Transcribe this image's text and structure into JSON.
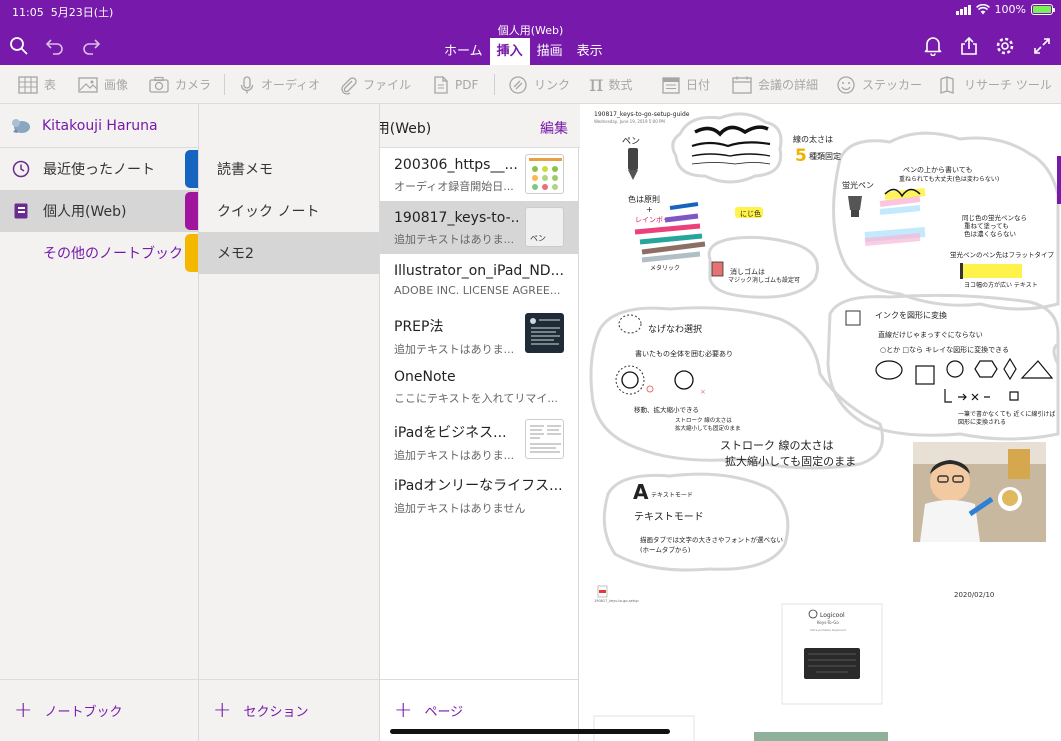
{
  "status_bar": {
    "time": "11:05",
    "date": "5月23日(土)",
    "battery": "100%",
    "battery_level": 1.0
  },
  "app": {
    "document_title": "個人用(Web)",
    "tabs": [
      {
        "label": "ホーム",
        "active": false
      },
      {
        "label": "挿入",
        "active": true
      },
      {
        "label": "描画",
        "active": false
      },
      {
        "label": "表示",
        "active": false
      }
    ],
    "toolbar_icons": [
      "search-icon",
      "undo-icon",
      "redo-icon",
      "bell-icon",
      "share-icon",
      "settings-icon",
      "expand-icon"
    ]
  },
  "ribbon": {
    "items": [
      {
        "icon": "table-icon",
        "label": "表"
      },
      {
        "icon": "image-icon",
        "label": "画像"
      },
      {
        "icon": "camera-icon",
        "label": "カメラ"
      },
      {
        "icon": "microphone-icon",
        "label": "オーディオ"
      },
      {
        "icon": "paperclip-icon",
        "label": "ファイル"
      },
      {
        "icon": "pdf-icon",
        "label": "PDF"
      },
      {
        "icon": "link-icon",
        "label": "リンク"
      },
      {
        "icon": "pi-icon",
        "label": "数式"
      },
      {
        "icon": "calendar-icon",
        "label": "日付"
      },
      {
        "icon": "meeting-icon",
        "label": "会議の詳細"
      },
      {
        "icon": "smiley-icon",
        "label": "ステッカー"
      },
      {
        "icon": "research-icon",
        "label": "リサーチ ツール"
      }
    ]
  },
  "notebooks_pane": {
    "account_name": "Kitakouji Haruna",
    "items": [
      {
        "label": "最近使ったノート",
        "icon": "clock-icon",
        "tag_color": "#1565c0",
        "selected": false
      },
      {
        "label": "個人用(Web)",
        "icon": "notebook-icon",
        "tag_color": "#a0159e",
        "selected": true
      }
    ],
    "other_notebooks": "その他のノートブック",
    "other_tag_color": "#f5b800",
    "footer_label": "ノートブック"
  },
  "sections_pane": {
    "header_title": "個人用(Web)",
    "edit_label": "編集",
    "items": [
      {
        "label": "読書メモ",
        "selected": false
      },
      {
        "label": "クイック ノート",
        "selected": false
      },
      {
        "label": "メモ2",
        "selected": true
      }
    ],
    "footer_label": "セクション"
  },
  "pages_pane": {
    "items": [
      {
        "title": "200306_https__...",
        "snippet": "オーディオ録音開始日...",
        "selected": false
      },
      {
        "title": "190817_keys-to-...",
        "snippet": "追加テキストはありま...",
        "selected": true,
        "thumb_text": "ペン"
      },
      {
        "title": "Illustrator_on_iPad_ND...",
        "snippet": "ADOBE INC.  LICENSE AGREE...",
        "selected": false
      },
      {
        "title": "PREP法",
        "snippet": "追加テキストはありま...",
        "selected": false
      },
      {
        "title": "OneNote",
        "snippet": "ここにテキストを入れてリマイ...",
        "selected": false
      },
      {
        "title": "iPadをビジネス...",
        "snippet": "追加テキストはありま...",
        "selected": false
      },
      {
        "title": "iPadオンリーなライフス...",
        "snippet": "追加テキストはありません",
        "selected": false
      }
    ],
    "footer_label": "ページ"
  },
  "canvas": {
    "page_header": "190817_keys-to-go-setup-guide",
    "page_subheader": "Wednesday, June 19, 2019      5:00 PM",
    "notes": {
      "pen": "ペン",
      "line_width_1": "線の太さは",
      "line_width_2": "5",
      "line_width_3": "種類固定",
      "colors_1": "色は原則",
      "colors_2": "+",
      "rainbow": "レインボー",
      "metallic": "メタリック",
      "rainbow_label": "にじ色",
      "eraser_1": "消しゴムは",
      "eraser_2": "マジック消しゴムも設定可",
      "highlighter": "蛍光ペン",
      "hl_note_1": "ペンの上から書いても",
      "hl_note_2": "重ねられても大丈夫(色は変わらない)",
      "hl_same_1": "同じ色の蛍光ペンなら",
      "hl_same_2": "重ねて塗っても",
      "hl_same_3": "色は濃くならない",
      "hl_tip": "蛍光ペンのペン先はフラットタイプ",
      "hl_width": "ヨコ幅の方が広い テキスト",
      "lasso": "なげなわ選択",
      "lasso_note": "書いたもの全体を囲む必要あり",
      "move": "移動、拡大縮小できる",
      "stroke_note_1": "ストローク 線の太さは",
      "stroke_note_2": "拡大縮小しても固定のまま",
      "big_stroke_1": "ストローク 線の太さは",
      "big_stroke_2": "拡大縮小しても固定のまま",
      "shape_title": "インクを図形に変換",
      "shape_note_1": "直線だけじゃまっすぐにならない",
      "shape_note_2": "○とか □なら キレイな図形に変換できる",
      "shape_note_3": "一筆で書かなくても 近くに線引けば",
      "shape_note_4": "図形に変換される",
      "text_mode_big": "A",
      "text_mode_small": "テキストモード",
      "text_mode_label": "テキストモード",
      "text_mode_note_1": "描画タブでは文字の大きさやフォントが選べない",
      "text_mode_note_2": "(ホームタブから)",
      "date": "2020/02/10",
      "attachment": "190817_keys-to-go-setup",
      "doc_brand": "Logicool",
      "doc_product": "Keys-To-Go",
      "doc_sub": "Ultra-portable keyboard"
    }
  }
}
